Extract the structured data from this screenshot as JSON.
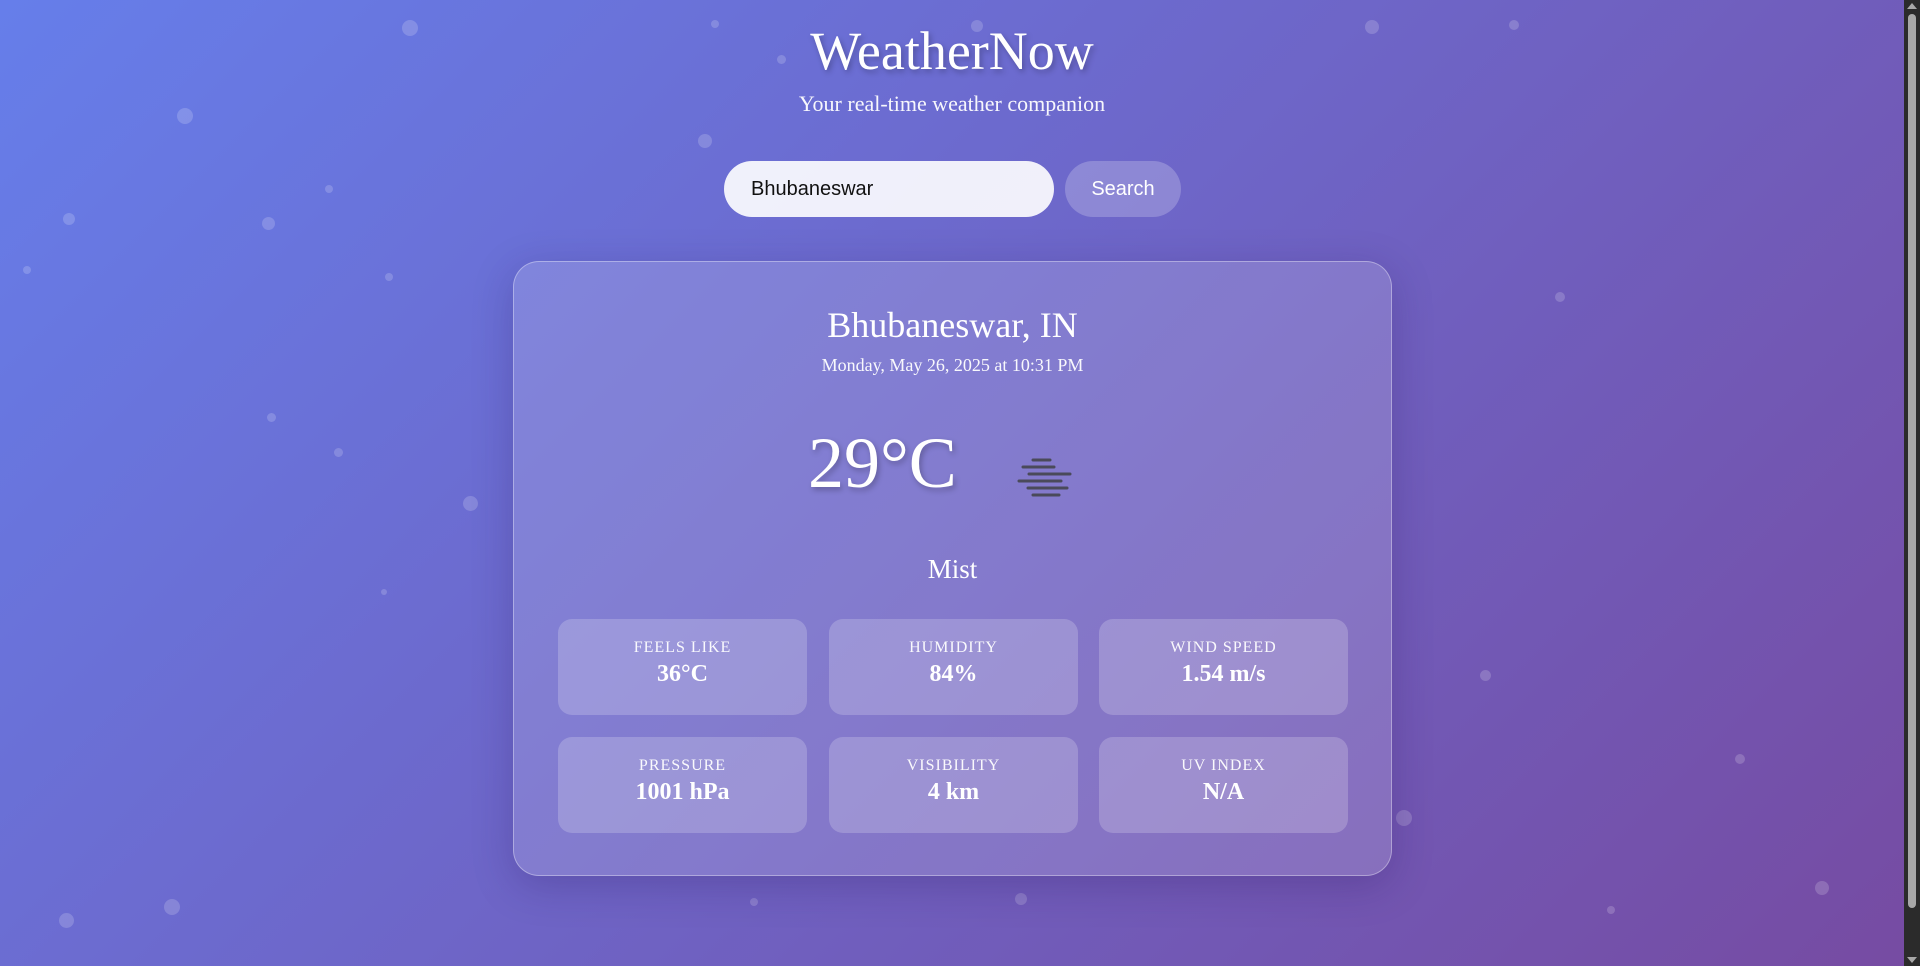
{
  "header": {
    "title": "WeatherNow",
    "subtitle": "Your real-time weather companion"
  },
  "search": {
    "value": "Bhubaneswar",
    "placeholder": "",
    "button_label": "Search"
  },
  "weather": {
    "location": "Bhubaneswar, IN",
    "datetime": "Monday, May 26, 2025 at 10:31 PM",
    "temperature": "29°C",
    "icon": "mist-icon",
    "condition": "Mist",
    "stats": [
      {
        "label": "FEELS LIKE",
        "value": "36°C"
      },
      {
        "label": "HUMIDITY",
        "value": "84%"
      },
      {
        "label": "WIND SPEED",
        "value": "1.54 m/s"
      },
      {
        "label": "PRESSURE",
        "value": "1001 hPa"
      },
      {
        "label": "VISIBILITY",
        "value": "4 km"
      },
      {
        "label": "UV INDEX",
        "value": "N/A"
      }
    ]
  },
  "colors": {
    "gradient_start": "#667eea",
    "gradient_end": "#764ba2",
    "text": "#ffffff"
  }
}
